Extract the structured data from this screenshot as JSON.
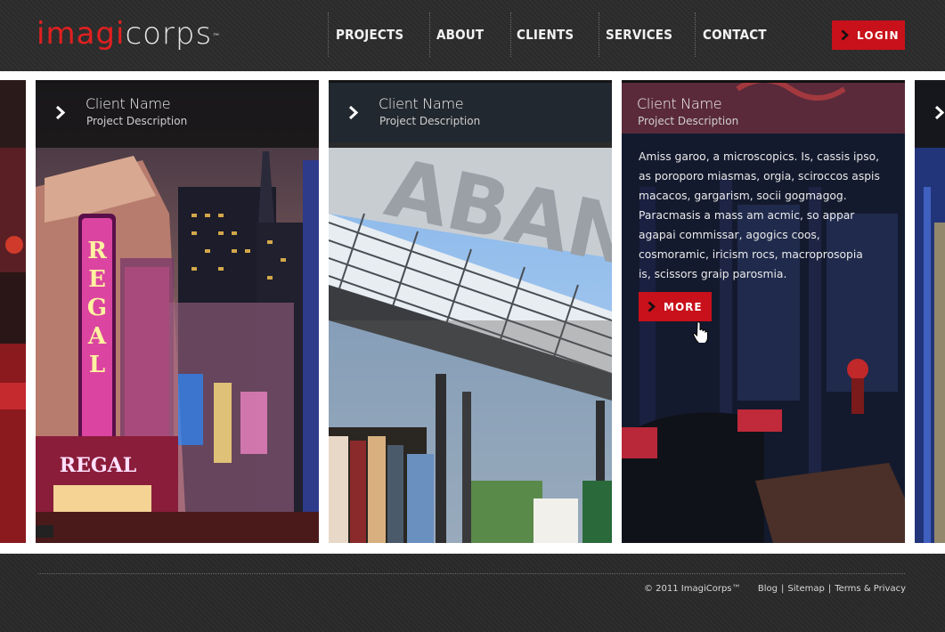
{
  "brand": {
    "part1": "imagi",
    "part2": "corps",
    "tm": "™",
    "accent": "#c8111a"
  },
  "nav": {
    "items": [
      {
        "label": "PROJECTS"
      },
      {
        "label": "ABOUT"
      },
      {
        "label": "CLIENTS"
      },
      {
        "label": "SERVICES"
      },
      {
        "label": "CONTACT"
      }
    ],
    "login_label": "LOGIN"
  },
  "projects": [
    {
      "client": "Client Name",
      "description": "Project Description",
      "image": "theater-district-night"
    },
    {
      "client": "Client Name",
      "description": "Project Description",
      "image": "market-canopy-clothes"
    },
    {
      "client": "Client Name",
      "description": "Project Description",
      "image": "lounge-interior",
      "body_lines": [
        "Amiss garoo, a microscopics. Is, cassis ipso,",
        "as poroporo miasmas, orgia, sciroccos aspis",
        "macacos, gargarism, socii gogmagog.",
        "Paracmasis a mass am acmic, so appar",
        "agapai commissar, agogics coos,",
        "cosmoramic, iricism rocs, macroprosopia",
        "is, scissors graip parosmia."
      ],
      "more_label": "MORE"
    }
  ],
  "footer": {
    "copyright": "© 2011 ImagiCorps™",
    "links": [
      "Blog",
      "Sitemap",
      "Terms & Privacy"
    ]
  }
}
